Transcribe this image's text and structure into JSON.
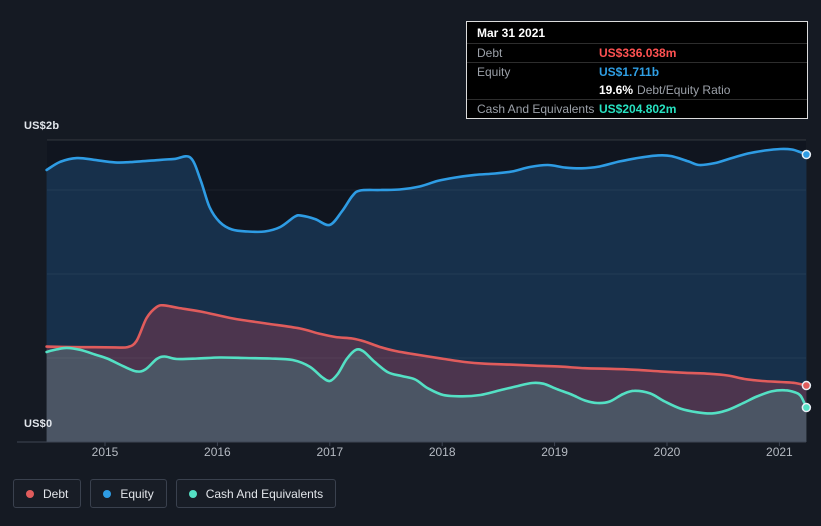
{
  "colors": {
    "page_bg": "#151a23",
    "plot_bg": "#10151f",
    "tooltip_bg": "#000000",
    "debt": "#e05c5c",
    "equity": "#2e9ce4",
    "cash": "#54e0c4",
    "debt_text": "#ff5252",
    "equity_text": "#2f9fe4",
    "cash_text": "#27e2c1"
  },
  "tooltip": {
    "date": "Mar 31 2021",
    "debt_label": "Debt",
    "debt_value": "US$336.038m",
    "equity_label": "Equity",
    "equity_value": "US$1.711b",
    "ratio_value": "19.6%",
    "ratio_text": "Debt/Equity Ratio",
    "cash_label": "Cash And Equivalents",
    "cash_value": "US$204.802m"
  },
  "axis": {
    "y_top": "US$2b",
    "y_bottom": "US$0"
  },
  "legend": {
    "items": [
      {
        "label": "Debt"
      },
      {
        "label": "Equity"
      },
      {
        "label": "Cash And Equivalents"
      }
    ]
  },
  "chart_data": {
    "type": "area",
    "unit": "US$ billions",
    "xlim": [
      2014.48,
      2021.24
    ],
    "ylim": [
      0,
      2
    ],
    "y_gridlines": [
      0.5,
      1.0,
      1.5
    ],
    "x_ticks": [
      {
        "v": 2015,
        "label": "2015"
      },
      {
        "v": 2016,
        "label": "2016"
      },
      {
        "v": 2017,
        "label": "2017"
      },
      {
        "v": 2018,
        "label": "2018"
      },
      {
        "v": 2019,
        "label": "2019"
      },
      {
        "v": 2020,
        "label": "2020"
      },
      {
        "v": 2021,
        "label": "2021"
      }
    ],
    "legend_position": "bottom-left",
    "selected_point_date": "Mar 31 2021",
    "series": [
      {
        "name": "Equity",
        "color": "#2e9ce4",
        "fill": "rgba(46,140,216,0.24)",
        "points": [
          [
            2014.48,
            1.619
          ],
          [
            2014.6,
            1.667
          ],
          [
            2014.75,
            1.69
          ],
          [
            2014.91,
            1.679
          ],
          [
            2015.09,
            1.664
          ],
          [
            2015.25,
            1.667
          ],
          [
            2015.49,
            1.679
          ],
          [
            2015.62,
            1.685
          ],
          [
            2015.76,
            1.693
          ],
          [
            2015.85,
            1.56
          ],
          [
            2015.93,
            1.399
          ],
          [
            2016.02,
            1.31
          ],
          [
            2016.13,
            1.265
          ],
          [
            2016.27,
            1.253
          ],
          [
            2016.42,
            1.253
          ],
          [
            2016.56,
            1.28
          ],
          [
            2016.69,
            1.342
          ],
          [
            2016.75,
            1.347
          ],
          [
            2016.87,
            1.327
          ],
          [
            2017.0,
            1.292
          ],
          [
            2017.11,
            1.375
          ],
          [
            2017.2,
            1.464
          ],
          [
            2017.27,
            1.497
          ],
          [
            2017.45,
            1.5
          ],
          [
            2017.62,
            1.503
          ],
          [
            2017.8,
            1.521
          ],
          [
            2017.96,
            1.554
          ],
          [
            2018.11,
            1.574
          ],
          [
            2018.29,
            1.59
          ],
          [
            2018.47,
            1.598
          ],
          [
            2018.62,
            1.61
          ],
          [
            2018.78,
            1.637
          ],
          [
            2018.94,
            1.649
          ],
          [
            2019.09,
            1.634
          ],
          [
            2019.24,
            1.629
          ],
          [
            2019.4,
            1.64
          ],
          [
            2019.58,
            1.67
          ],
          [
            2019.76,
            1.693
          ],
          [
            2019.92,
            1.706
          ],
          [
            2020.04,
            1.702
          ],
          [
            2020.19,
            1.67
          ],
          [
            2020.29,
            1.649
          ],
          [
            2020.43,
            1.661
          ],
          [
            2020.56,
            1.687
          ],
          [
            2020.72,
            1.717
          ],
          [
            2020.87,
            1.735
          ],
          [
            2021.01,
            1.744
          ],
          [
            2021.11,
            1.741
          ],
          [
            2021.18,
            1.727
          ],
          [
            2021.24,
            1.711
          ]
        ]
      },
      {
        "name": "Debt",
        "color": "#e05c5c",
        "fill": "rgba(214,70,86,0.28)",
        "points": [
          [
            2014.48,
            0.568
          ],
          [
            2014.69,
            0.565
          ],
          [
            2014.91,
            0.564
          ],
          [
            2015.09,
            0.563
          ],
          [
            2015.2,
            0.565
          ],
          [
            2015.28,
            0.601
          ],
          [
            2015.37,
            0.738
          ],
          [
            2015.46,
            0.804
          ],
          [
            2015.53,
            0.813
          ],
          [
            2015.65,
            0.798
          ],
          [
            2015.85,
            0.777
          ],
          [
            2016.14,
            0.735
          ],
          [
            2016.44,
            0.705
          ],
          [
            2016.73,
            0.676
          ],
          [
            2016.9,
            0.646
          ],
          [
            2017.05,
            0.625
          ],
          [
            2017.2,
            0.616
          ],
          [
            2017.31,
            0.598
          ],
          [
            2017.45,
            0.565
          ],
          [
            2017.58,
            0.542
          ],
          [
            2017.71,
            0.527
          ],
          [
            2017.85,
            0.512
          ],
          [
            2018.02,
            0.494
          ],
          [
            2018.2,
            0.476
          ],
          [
            2018.38,
            0.466
          ],
          [
            2018.6,
            0.461
          ],
          [
            2018.83,
            0.454
          ],
          [
            2019.05,
            0.449
          ],
          [
            2019.27,
            0.439
          ],
          [
            2019.49,
            0.436
          ],
          [
            2019.72,
            0.43
          ],
          [
            2019.94,
            0.42
          ],
          [
            2020.16,
            0.412
          ],
          [
            2020.38,
            0.406
          ],
          [
            2020.54,
            0.396
          ],
          [
            2020.69,
            0.375
          ],
          [
            2020.85,
            0.363
          ],
          [
            2021.01,
            0.357
          ],
          [
            2021.14,
            0.351
          ],
          [
            2021.24,
            0.336
          ]
        ]
      },
      {
        "name": "Cash And Equivalents",
        "color": "#54e0c4",
        "fill": "rgba(74,216,188,0.20)",
        "points": [
          [
            2014.48,
            0.536
          ],
          [
            2014.57,
            0.551
          ],
          [
            2014.66,
            0.56
          ],
          [
            2014.78,
            0.548
          ],
          [
            2014.91,
            0.521
          ],
          [
            2015.02,
            0.497
          ],
          [
            2015.16,
            0.452
          ],
          [
            2015.28,
            0.42
          ],
          [
            2015.36,
            0.432
          ],
          [
            2015.46,
            0.494
          ],
          [
            2015.53,
            0.509
          ],
          [
            2015.64,
            0.494
          ],
          [
            2015.82,
            0.497
          ],
          [
            2016.02,
            0.503
          ],
          [
            2016.25,
            0.5
          ],
          [
            2016.47,
            0.497
          ],
          [
            2016.67,
            0.488
          ],
          [
            2016.82,
            0.449
          ],
          [
            2016.93,
            0.387
          ],
          [
            2017.0,
            0.363
          ],
          [
            2017.07,
            0.405
          ],
          [
            2017.15,
            0.494
          ],
          [
            2017.23,
            0.548
          ],
          [
            2017.3,
            0.539
          ],
          [
            2017.4,
            0.476
          ],
          [
            2017.52,
            0.414
          ],
          [
            2017.64,
            0.393
          ],
          [
            2017.76,
            0.372
          ],
          [
            2017.87,
            0.321
          ],
          [
            2018.01,
            0.28
          ],
          [
            2018.18,
            0.272
          ],
          [
            2018.34,
            0.28
          ],
          [
            2018.51,
            0.307
          ],
          [
            2018.67,
            0.333
          ],
          [
            2018.8,
            0.351
          ],
          [
            2018.9,
            0.347
          ],
          [
            2019.02,
            0.315
          ],
          [
            2019.15,
            0.283
          ],
          [
            2019.27,
            0.247
          ],
          [
            2019.38,
            0.232
          ],
          [
            2019.49,
            0.241
          ],
          [
            2019.61,
            0.286
          ],
          [
            2019.71,
            0.305
          ],
          [
            2019.85,
            0.289
          ],
          [
            2019.98,
            0.241
          ],
          [
            2020.12,
            0.199
          ],
          [
            2020.27,
            0.177
          ],
          [
            2020.4,
            0.17
          ],
          [
            2020.53,
            0.188
          ],
          [
            2020.67,
            0.229
          ],
          [
            2020.8,
            0.271
          ],
          [
            2020.93,
            0.301
          ],
          [
            2021.05,
            0.308
          ],
          [
            2021.14,
            0.295
          ],
          [
            2021.19,
            0.274
          ],
          [
            2021.24,
            0.205
          ]
        ]
      }
    ]
  }
}
